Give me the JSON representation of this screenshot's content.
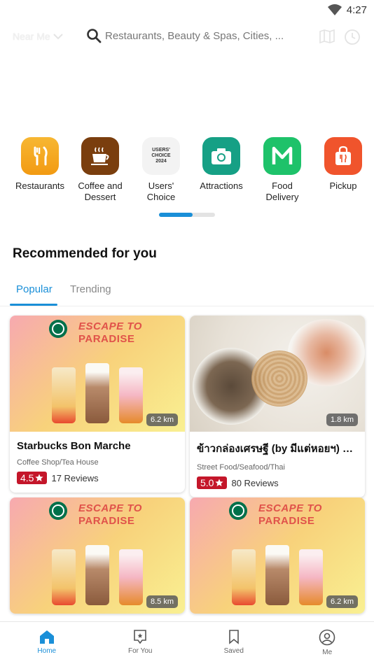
{
  "status_bar": {
    "time": "4:27"
  },
  "header": {
    "location_label": "Near Me",
    "search_placeholder": "Restaurants, Beauty & Spas, Cities, ..."
  },
  "categories": [
    {
      "label_line1": "Restaurants",
      "label_line2": "",
      "color": "#f4a61a",
      "icon": "fork-knife-icon"
    },
    {
      "label_line1": "Coffee and",
      "label_line2": "Dessert",
      "color": "#7a3e0e",
      "icon": "coffee-cup-icon"
    },
    {
      "label_line1": "Users'",
      "label_line2": "Choice",
      "color": "#f1f1f1",
      "icon": "users-choice-badge-icon",
      "badge_line1": "USERS'",
      "badge_line2": "CHOICE",
      "badge_line3": "2024"
    },
    {
      "label_line1": "Attractions",
      "label_line2": "",
      "color": "#16a085",
      "icon": "camera-icon"
    },
    {
      "label_line1": "Food",
      "label_line2": "Delivery",
      "color": "#1ec26a",
      "icon": "m-delivery-icon"
    },
    {
      "label_line1": "Pickup",
      "label_line2": "",
      "color": "#f0542c",
      "icon": "pickup-bag-icon"
    }
  ],
  "category_pager": {
    "progress": 0.6
  },
  "section": {
    "title": "Recommended for you"
  },
  "tabs": [
    {
      "label": "Popular",
      "active": true
    },
    {
      "label": "Trending",
      "active": false
    }
  ],
  "promo": {
    "line1": "ESCAPE TO",
    "line2": "PARADISE"
  },
  "cards": [
    {
      "name": "Starbucks Bon Marche",
      "category": "Coffee Shop/Tea House",
      "rating": "4.5",
      "reviews": "17 Reviews",
      "distance": "6.2 km"
    },
    {
      "name": "ข้าวกล่องเศรษฐี (by มีแต่หอยฯ) บา...",
      "category": "Street Food/Seafood/Thai",
      "rating": "5.0",
      "reviews": "80 Reviews",
      "distance": "1.8 km"
    },
    {
      "distance": "8.5 km"
    },
    {
      "distance": "6.2 km"
    }
  ],
  "bottom_nav": [
    {
      "label": "Home",
      "icon": "home-icon",
      "active": true
    },
    {
      "label": "For You",
      "icon": "for-you-icon",
      "active": false
    },
    {
      "label": "Saved",
      "icon": "bookmark-icon",
      "active": false
    },
    {
      "label": "Me",
      "icon": "profile-icon",
      "active": false
    }
  ],
  "colors": {
    "accent": "#1a8fd8",
    "rating": "#c4162a",
    "promo_text": "#e0524a"
  }
}
